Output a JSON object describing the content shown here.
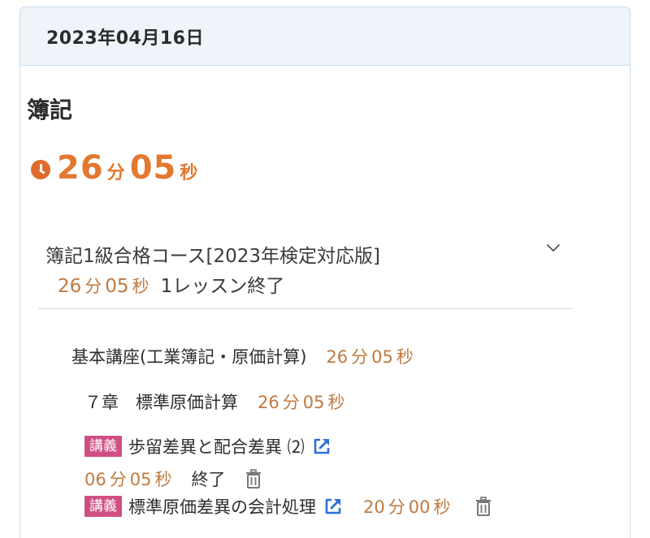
{
  "header": {
    "date": "2023年04月16日"
  },
  "subject": "簿記",
  "total": {
    "min": "26",
    "min_unit": "分",
    "sec": "05",
    "sec_unit": "秒"
  },
  "course": {
    "title": "簿記1級合格コース[2023年検定対応版]",
    "time": {
      "min": "26",
      "min_unit": "分",
      "sec": "05",
      "sec_unit": "秒"
    },
    "lessons_done": "1レッスン終了"
  },
  "section": {
    "title": "基本講座(工業簿記・原価計算)",
    "time": {
      "min": "26",
      "min_unit": "分",
      "sec": "05",
      "sec_unit": "秒"
    }
  },
  "chapter": {
    "title": "７章　標準原価計算",
    "time": {
      "min": "26",
      "min_unit": "分",
      "sec": "05",
      "sec_unit": "秒"
    }
  },
  "lessons": [
    {
      "badge": "講義",
      "title": "歩留差異と配合差異 ⑵",
      "time": {
        "min": "06",
        "min_unit": "分",
        "sec": "05",
        "sec_unit": "秒"
      },
      "status": "終了"
    },
    {
      "badge": "講義",
      "title": "標準原価差異の会計処理",
      "time": {
        "min": "20",
        "min_unit": "分",
        "sec": "00",
        "sec_unit": "秒"
      }
    }
  ],
  "colors": {
    "accent_orange": "#e3782f",
    "time_orange": "#c07a3f",
    "badge_pink": "#d04f83",
    "link_blue": "#2f6fd6",
    "header_bg": "#eef4f9"
  },
  "icons": {
    "clock": "clock-icon",
    "chevron": "chevron-down-icon",
    "external": "external-link-icon",
    "trash": "trash-icon"
  }
}
